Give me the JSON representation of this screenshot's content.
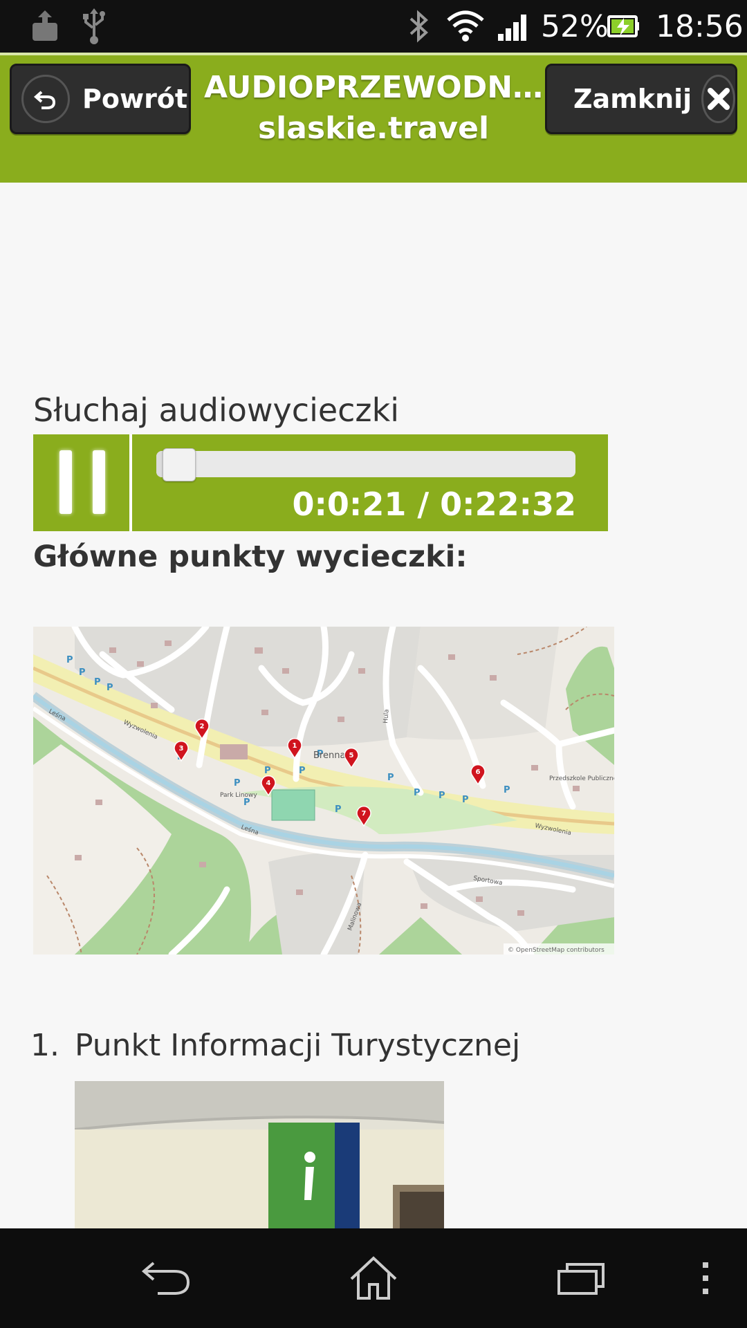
{
  "status_bar": {
    "battery_percent": "52%",
    "time": "18:56",
    "icons": [
      "download-icon",
      "usb-icon",
      "bluetooth-icon",
      "wifi-icon",
      "signal-icon",
      "battery-charging-icon"
    ]
  },
  "header": {
    "back_label": "Powrót",
    "title_line1": "AUDIOPRZEWODN…",
    "title_line2": "slaskie.travel",
    "close_label": "Zamknij"
  },
  "player": {
    "label": "Słuchaj audiowycieczki",
    "time": "0:0:21 / 0:22:32",
    "progress": 0.0157,
    "state": "playing"
  },
  "points": {
    "heading": "Główne punkty wycieczki:",
    "map_labels": {
      "brenna": "Brenna",
      "wyzwolenia_1": "Wyzwolenia",
      "wyzwolenia_2": "Wyzwolenia",
      "lesna_1": "Leśna",
      "lesna_2": "Leśna",
      "malinowa": "Malinowa",
      "sportowa": "Sportowa",
      "hula": "Hula",
      "przedszkole": "Przedszkole Publiczne",
      "park": "Park Linowy",
      "attribution": "© OpenStreetMap contributors"
    },
    "markers": [
      "1",
      "2",
      "3",
      "4",
      "5",
      "6",
      "7"
    ],
    "items": [
      {
        "number": "1.",
        "label": "Punkt Informacji Turystycznej"
      }
    ]
  },
  "colors": {
    "accent": "#8aad1d",
    "header_button": "#2e2e2e",
    "text": "#333333",
    "marker": "#d0141e"
  }
}
